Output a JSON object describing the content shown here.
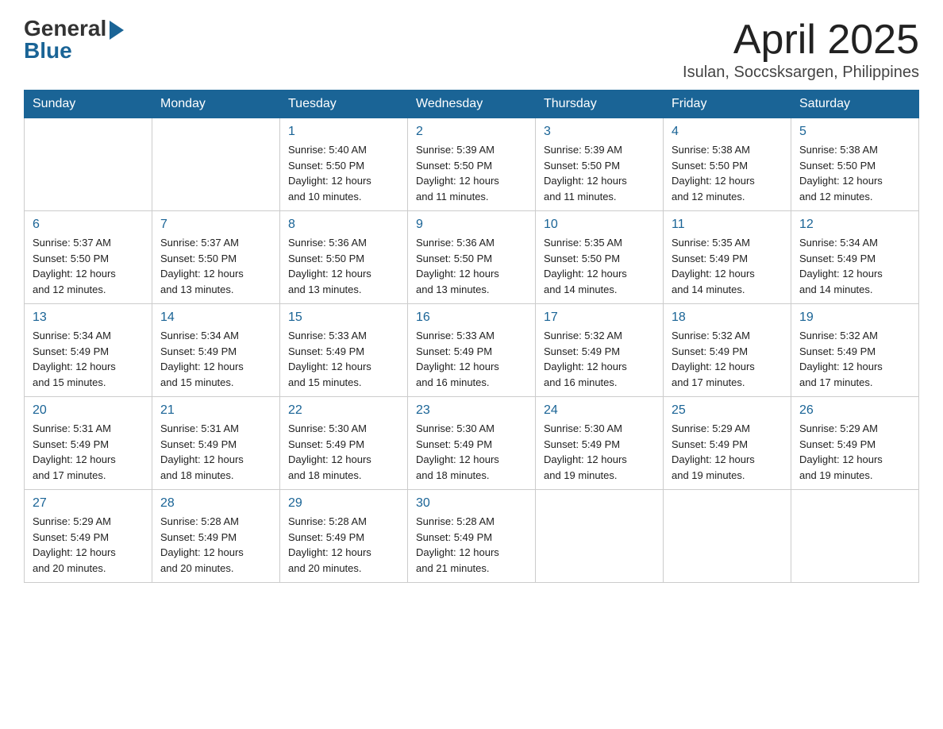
{
  "header": {
    "logo_general": "General",
    "logo_blue": "Blue",
    "month_title": "April 2025",
    "location": "Isulan, Soccsksargen, Philippines"
  },
  "days_of_week": [
    "Sunday",
    "Monday",
    "Tuesday",
    "Wednesday",
    "Thursday",
    "Friday",
    "Saturday"
  ],
  "weeks": [
    [
      {
        "day": "",
        "info": ""
      },
      {
        "day": "",
        "info": ""
      },
      {
        "day": "1",
        "info": "Sunrise: 5:40 AM\nSunset: 5:50 PM\nDaylight: 12 hours\nand 10 minutes."
      },
      {
        "day": "2",
        "info": "Sunrise: 5:39 AM\nSunset: 5:50 PM\nDaylight: 12 hours\nand 11 minutes."
      },
      {
        "day": "3",
        "info": "Sunrise: 5:39 AM\nSunset: 5:50 PM\nDaylight: 12 hours\nand 11 minutes."
      },
      {
        "day": "4",
        "info": "Sunrise: 5:38 AM\nSunset: 5:50 PM\nDaylight: 12 hours\nand 12 minutes."
      },
      {
        "day": "5",
        "info": "Sunrise: 5:38 AM\nSunset: 5:50 PM\nDaylight: 12 hours\nand 12 minutes."
      }
    ],
    [
      {
        "day": "6",
        "info": "Sunrise: 5:37 AM\nSunset: 5:50 PM\nDaylight: 12 hours\nand 12 minutes."
      },
      {
        "day": "7",
        "info": "Sunrise: 5:37 AM\nSunset: 5:50 PM\nDaylight: 12 hours\nand 13 minutes."
      },
      {
        "day": "8",
        "info": "Sunrise: 5:36 AM\nSunset: 5:50 PM\nDaylight: 12 hours\nand 13 minutes."
      },
      {
        "day": "9",
        "info": "Sunrise: 5:36 AM\nSunset: 5:50 PM\nDaylight: 12 hours\nand 13 minutes."
      },
      {
        "day": "10",
        "info": "Sunrise: 5:35 AM\nSunset: 5:50 PM\nDaylight: 12 hours\nand 14 minutes."
      },
      {
        "day": "11",
        "info": "Sunrise: 5:35 AM\nSunset: 5:49 PM\nDaylight: 12 hours\nand 14 minutes."
      },
      {
        "day": "12",
        "info": "Sunrise: 5:34 AM\nSunset: 5:49 PM\nDaylight: 12 hours\nand 14 minutes."
      }
    ],
    [
      {
        "day": "13",
        "info": "Sunrise: 5:34 AM\nSunset: 5:49 PM\nDaylight: 12 hours\nand 15 minutes."
      },
      {
        "day": "14",
        "info": "Sunrise: 5:34 AM\nSunset: 5:49 PM\nDaylight: 12 hours\nand 15 minutes."
      },
      {
        "day": "15",
        "info": "Sunrise: 5:33 AM\nSunset: 5:49 PM\nDaylight: 12 hours\nand 15 minutes."
      },
      {
        "day": "16",
        "info": "Sunrise: 5:33 AM\nSunset: 5:49 PM\nDaylight: 12 hours\nand 16 minutes."
      },
      {
        "day": "17",
        "info": "Sunrise: 5:32 AM\nSunset: 5:49 PM\nDaylight: 12 hours\nand 16 minutes."
      },
      {
        "day": "18",
        "info": "Sunrise: 5:32 AM\nSunset: 5:49 PM\nDaylight: 12 hours\nand 17 minutes."
      },
      {
        "day": "19",
        "info": "Sunrise: 5:32 AM\nSunset: 5:49 PM\nDaylight: 12 hours\nand 17 minutes."
      }
    ],
    [
      {
        "day": "20",
        "info": "Sunrise: 5:31 AM\nSunset: 5:49 PM\nDaylight: 12 hours\nand 17 minutes."
      },
      {
        "day": "21",
        "info": "Sunrise: 5:31 AM\nSunset: 5:49 PM\nDaylight: 12 hours\nand 18 minutes."
      },
      {
        "day": "22",
        "info": "Sunrise: 5:30 AM\nSunset: 5:49 PM\nDaylight: 12 hours\nand 18 minutes."
      },
      {
        "day": "23",
        "info": "Sunrise: 5:30 AM\nSunset: 5:49 PM\nDaylight: 12 hours\nand 18 minutes."
      },
      {
        "day": "24",
        "info": "Sunrise: 5:30 AM\nSunset: 5:49 PM\nDaylight: 12 hours\nand 19 minutes."
      },
      {
        "day": "25",
        "info": "Sunrise: 5:29 AM\nSunset: 5:49 PM\nDaylight: 12 hours\nand 19 minutes."
      },
      {
        "day": "26",
        "info": "Sunrise: 5:29 AM\nSunset: 5:49 PM\nDaylight: 12 hours\nand 19 minutes."
      }
    ],
    [
      {
        "day": "27",
        "info": "Sunrise: 5:29 AM\nSunset: 5:49 PM\nDaylight: 12 hours\nand 20 minutes."
      },
      {
        "day": "28",
        "info": "Sunrise: 5:28 AM\nSunset: 5:49 PM\nDaylight: 12 hours\nand 20 minutes."
      },
      {
        "day": "29",
        "info": "Sunrise: 5:28 AM\nSunset: 5:49 PM\nDaylight: 12 hours\nand 20 minutes."
      },
      {
        "day": "30",
        "info": "Sunrise: 5:28 AM\nSunset: 5:49 PM\nDaylight: 12 hours\nand 21 minutes."
      },
      {
        "day": "",
        "info": ""
      },
      {
        "day": "",
        "info": ""
      },
      {
        "day": "",
        "info": ""
      }
    ]
  ]
}
